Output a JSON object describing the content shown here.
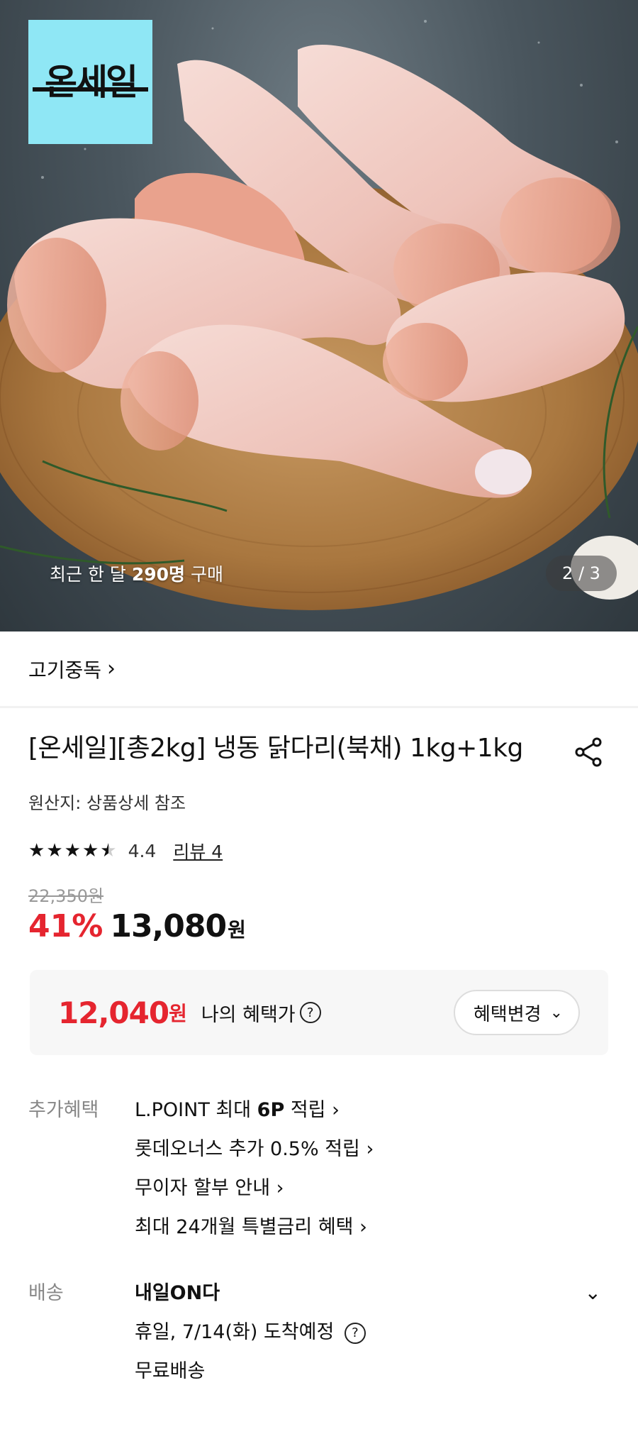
{
  "hero": {
    "logo_text": "온세일",
    "buyers_prefix": "최근 한 달 ",
    "buyers_count": "290명",
    "buyers_suffix": " 구매",
    "pager": "2 / 3"
  },
  "brand": {
    "name": "고기중독",
    "chevron": "›"
  },
  "product": {
    "title": "[온세일][총2kg] 냉동 닭다리(북채) 1kg+1kg",
    "origin": "원산지: 상품상세 참조",
    "rating": "4.4",
    "rating_value": 4.4,
    "review_link": "리뷰 4",
    "original_price": "22,350원",
    "discount": "41%",
    "price": "13,080",
    "currency": "원"
  },
  "benefit": {
    "price": "12,040",
    "currency": "원",
    "label": "나의 혜택가",
    "help": "?",
    "change_button": "혜택변경",
    "dropdown_glyph": "⌄"
  },
  "extra_benefits": {
    "label": "추가혜택",
    "items": [
      {
        "pre": "L.POINT 최대 ",
        "bold": "6P",
        "post": " 적립 ›"
      },
      {
        "pre": "롯데오너스 추가 0.5% 적립 ›",
        "bold": "",
        "post": ""
      },
      {
        "pre": "무이자 할부 안내 ›",
        "bold": "",
        "post": ""
      },
      {
        "pre": "최대 24개월 특별금리 혜택 ›",
        "bold": "",
        "post": ""
      }
    ]
  },
  "delivery": {
    "label": "배송",
    "service": "내일ON다",
    "arrival": "휴일, 7/14(화) 도착예정",
    "help": "?",
    "shipping": "무료배송",
    "collapse_glyph": "⌄"
  },
  "icons": {
    "share": "share-icon",
    "star": "star-icon",
    "help": "question-circle-icon",
    "chevron": "chevron-right-icon"
  },
  "colors": {
    "accent_red": "#e5252f",
    "logo_bg": "#8fe7f5",
    "box_bg": "#f7f7f7"
  }
}
